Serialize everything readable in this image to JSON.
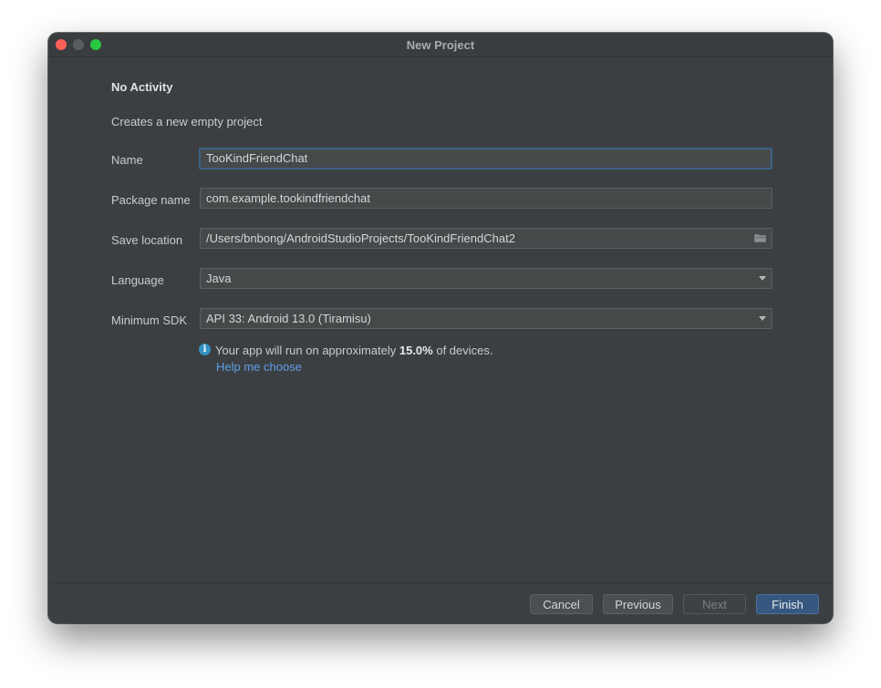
{
  "window": {
    "title": "New Project"
  },
  "form": {
    "heading": "No Activity",
    "description": "Creates a new empty project",
    "name": {
      "label": "Name",
      "value": "TooKindFriendChat"
    },
    "package_name": {
      "label": "Package name",
      "value": "com.example.tookindfriendchat"
    },
    "save_location": {
      "label": "Save location",
      "value": "/Users/bnbong/AndroidStudioProjects/TooKindFriendChat2",
      "icon": "folder-icon"
    },
    "language": {
      "label": "Language",
      "value": "Java"
    },
    "minimum_sdk": {
      "label": "Minimum SDK",
      "value": "API 33: Android 13.0 (Tiramisu)"
    }
  },
  "info": {
    "icon": "info-icon",
    "text_before": "Your app will run on approximately ",
    "percentage": "15.0%",
    "text_after": " of devices.",
    "help_link": "Help me choose"
  },
  "footer": {
    "cancel": "Cancel",
    "previous": "Previous",
    "next": "Next",
    "finish": "Finish"
  },
  "colors": {
    "window_bg": "#3c3f41",
    "accent_link": "#5e9fe8",
    "primary_button": "#365880",
    "close": "#ff5f57",
    "zoom": "#28c840"
  }
}
